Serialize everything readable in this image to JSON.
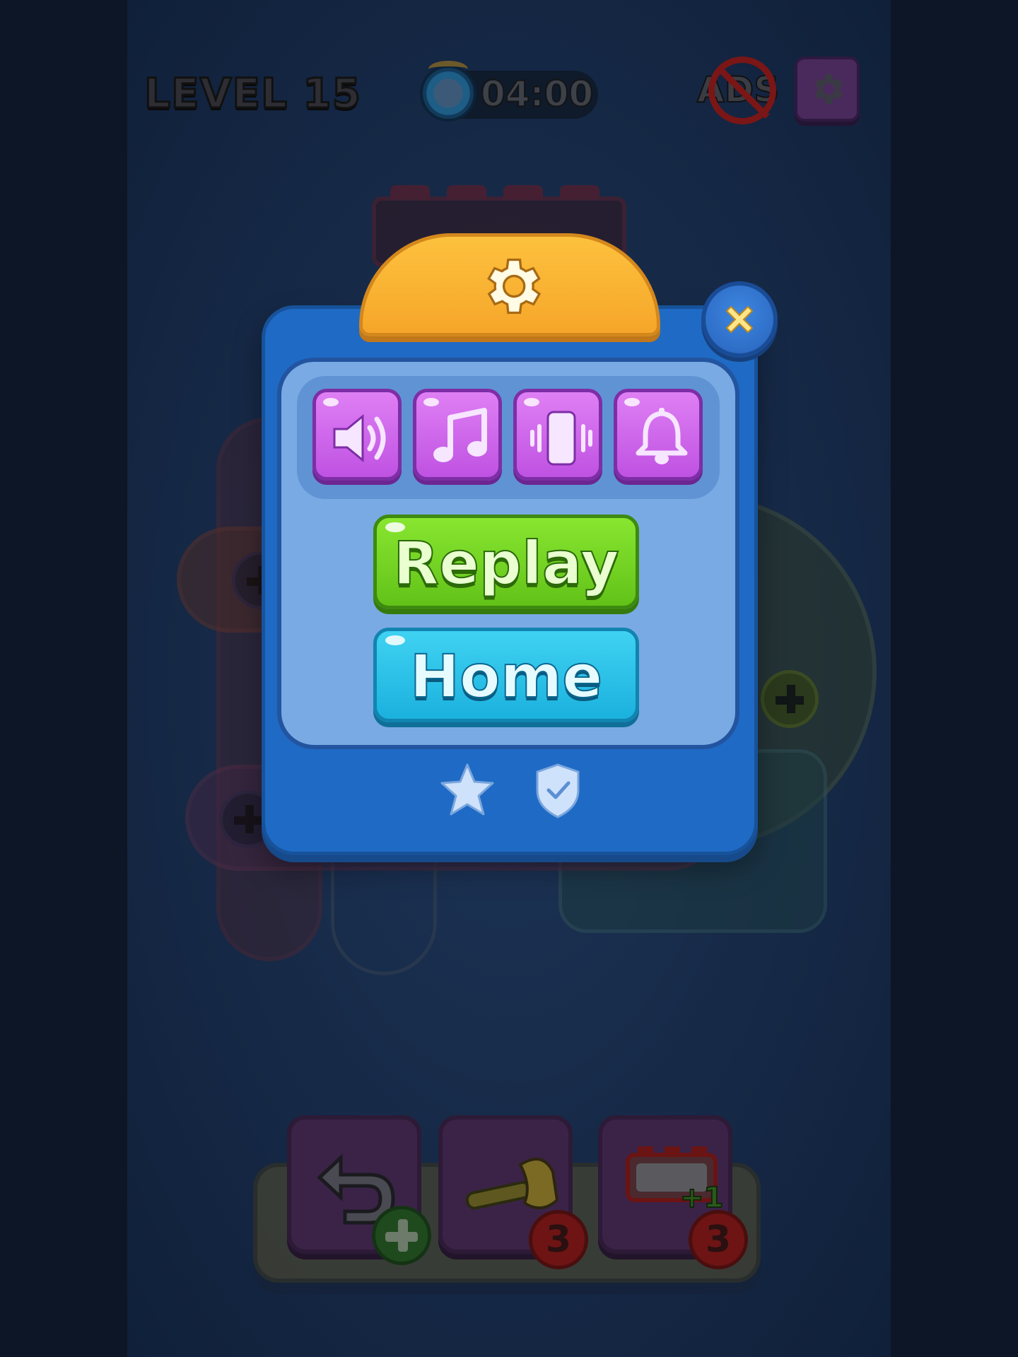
{
  "hud": {
    "level_label": "LEVEL 15",
    "timer": "04:00",
    "no_ads_label": "ADS"
  },
  "modal": {
    "replay_label": "Replay",
    "home_label": "Home",
    "toggles": [
      {
        "icon": "sound-icon"
      },
      {
        "icon": "music-icon"
      },
      {
        "icon": "vibration-icon"
      },
      {
        "icon": "notification-bell-icon"
      }
    ],
    "footer_icons": [
      "star-icon",
      "shield-check-icon"
    ]
  },
  "toolbar": {
    "tools": [
      {
        "icon": "undo-icon",
        "badge": "+"
      },
      {
        "icon": "hammer-icon",
        "badge": "3"
      },
      {
        "icon": "extra-slot-icon",
        "badge": "3",
        "overlay": "+1"
      }
    ]
  },
  "colors": {
    "modal_blue": "#1f6ac4",
    "header_orange": "#f6a62a",
    "toggle_purple": "#c85ce6",
    "replay_green": "#6ccc1e",
    "home_cyan": "#28bce4"
  }
}
